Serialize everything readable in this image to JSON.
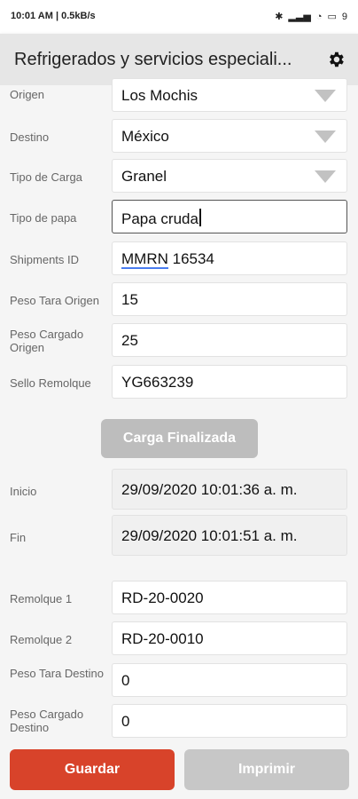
{
  "status": {
    "time": "10:01 AM",
    "speed": "0.5kB/s",
    "battery": "9"
  },
  "app": {
    "title": "Refrigerados y servicios especiali..."
  },
  "form": {
    "origen": {
      "label": "Origen",
      "value": "Los Mochis"
    },
    "destino": {
      "label": "Destino",
      "value": "México"
    },
    "tipo_carga": {
      "label": "Tipo de Carga",
      "value": "Granel"
    },
    "tipo_papa": {
      "label": "Tipo de papa",
      "value": "Papa cruda"
    },
    "shipments_id": {
      "label": "Shipments ID",
      "value_part1": "MMRN",
      "value_part2": " 16534"
    },
    "peso_tara_origen": {
      "label": "Peso Tara Origen",
      "value": "15"
    },
    "peso_cargado_origen": {
      "label": "Peso Cargado Origen",
      "value": "25"
    },
    "sello_remolque": {
      "label": "Sello Remolque",
      "value": "YG663239"
    },
    "carga_finalizada": "Carga Finalizada",
    "inicio": {
      "label": "Inicio",
      "value": "29/09/2020  10:01:36 a. m."
    },
    "fin": {
      "label": "Fin",
      "value": "29/09/2020  10:01:51 a. m."
    },
    "remolque1": {
      "label": "Remolque 1",
      "value": "RD-20-0020"
    },
    "remolque2": {
      "label": "Remolque 2",
      "value": "RD-20-0010"
    },
    "peso_tara_destino": {
      "label": "Peso Tara Destino",
      "value": "0"
    },
    "peso_cargado_destino": {
      "label": "Peso Cargado Destino",
      "value": "0"
    }
  },
  "buttons": {
    "guardar": "Guardar",
    "imprimir": "Imprimir"
  },
  "colors": {
    "guardar": "#d8432a",
    "disabled": "#c7c7c7"
  }
}
